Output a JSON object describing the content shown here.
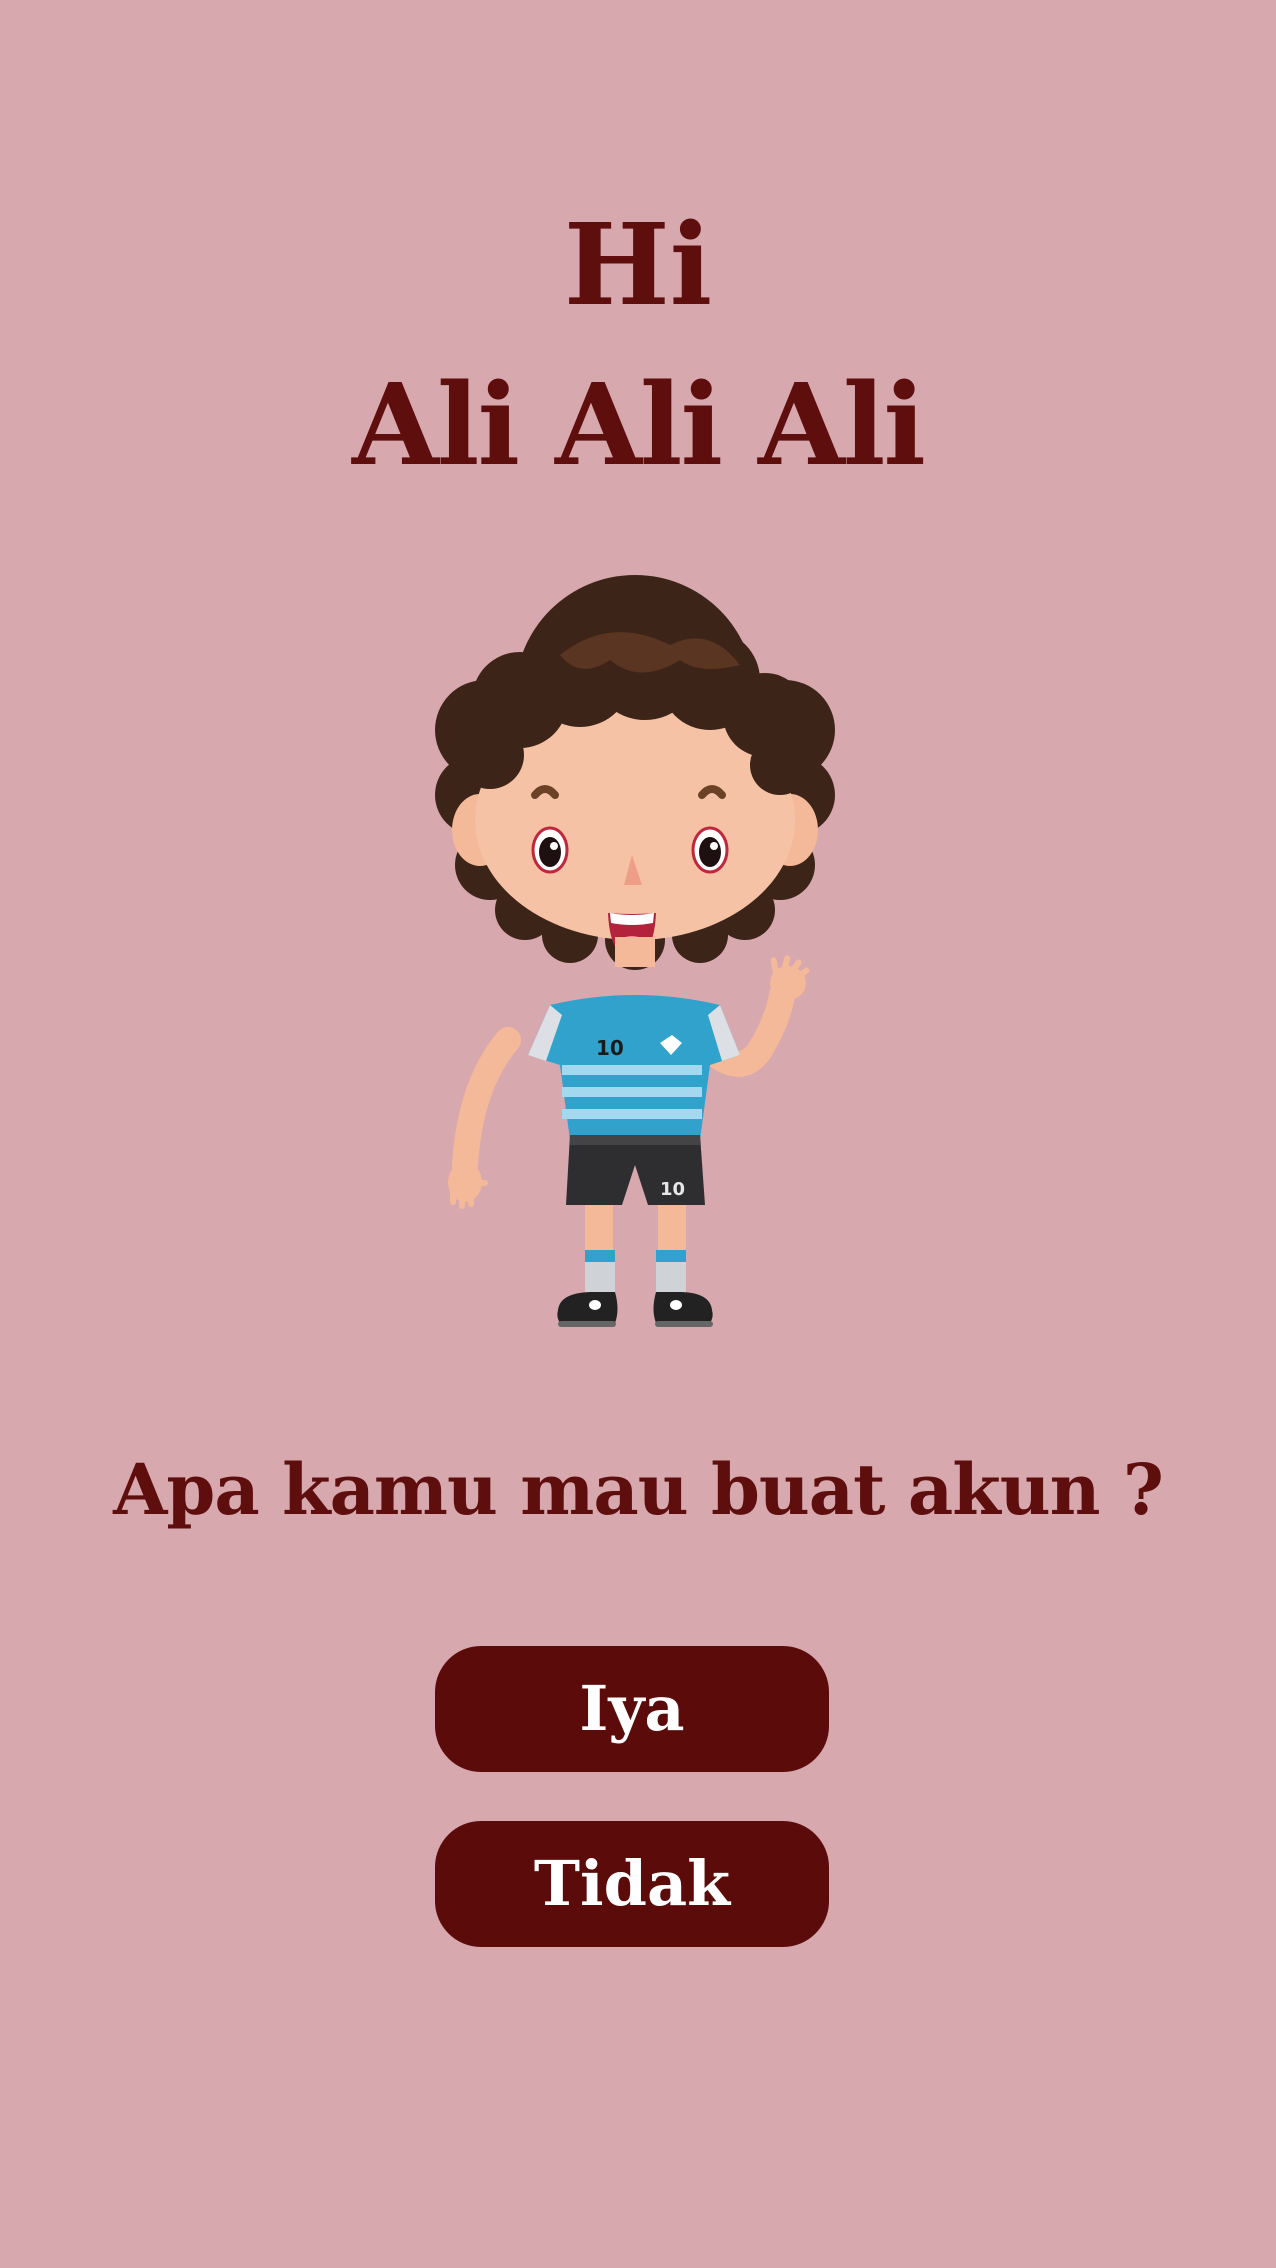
{
  "greeting": {
    "hi": "Hi",
    "name": "Ali Ali Ali"
  },
  "mascot": {
    "icon": "waving-boy-illustration",
    "jersey_number": "10"
  },
  "question": "Apa kamu mau buat akun ?",
  "buttons": {
    "yes_label": "Iya",
    "no_label": "Tidak"
  },
  "colors": {
    "background": "#d7a8ae",
    "text": "#5e0e0c",
    "button": "#5b0c0a",
    "button_text": "#ffffff"
  }
}
